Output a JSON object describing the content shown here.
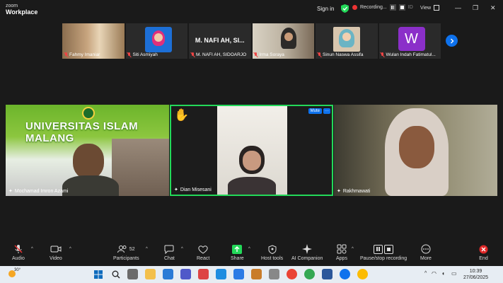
{
  "app": {
    "brand_top": "zoom",
    "brand_bottom": "Workplace"
  },
  "titlebar": {
    "signin": "Sign in",
    "recording": "Recording...",
    "id_label": "ID",
    "view": "View",
    "minimize": "—",
    "restore": "❐",
    "close": "✕"
  },
  "strip": [
    {
      "name": "Fahmy Imaniar",
      "mic_muted": true
    },
    {
      "name": "Siti Asmiyah",
      "mic_muted": true
    },
    {
      "name": "M. NAFI AH, SIDOARJO",
      "big": "M. NAFI AH, SI...",
      "mic_muted": true
    },
    {
      "name": "Irma Soraya",
      "mic_muted": true
    },
    {
      "name": "Sinun Naswa Assifa",
      "mic_muted": true
    },
    {
      "name": "Wulan Indah Fatimatul...",
      "avatar": "W",
      "mic_muted": true
    }
  ],
  "tiles": [
    {
      "name": "Mochamad Imron Azami",
      "banner": "UNIVERSITAS ISLAM MALANG"
    },
    {
      "name": "Dian Misesani",
      "mute": "Mute",
      "more": "···",
      "hand": "✋"
    },
    {
      "name": "Rakhmawati"
    }
  ],
  "toolbar": {
    "audio": "Audio",
    "video": "Video",
    "participants": "Participants",
    "participants_count": "52",
    "chat": "Chat",
    "react": "React",
    "share": "Share",
    "host_tools": "Host tools",
    "ai_companion": "AI Companion",
    "apps": "Apps",
    "pause_recording": "Pause/stop recording",
    "more": "More",
    "end": "End"
  },
  "taskbar": {
    "temp": "30°",
    "time": "10:39",
    "date": "27/06/2025",
    "colors": {
      "accent": "#0e72ed",
      "speaker": "#23d959",
      "end": "#e02828"
    }
  }
}
